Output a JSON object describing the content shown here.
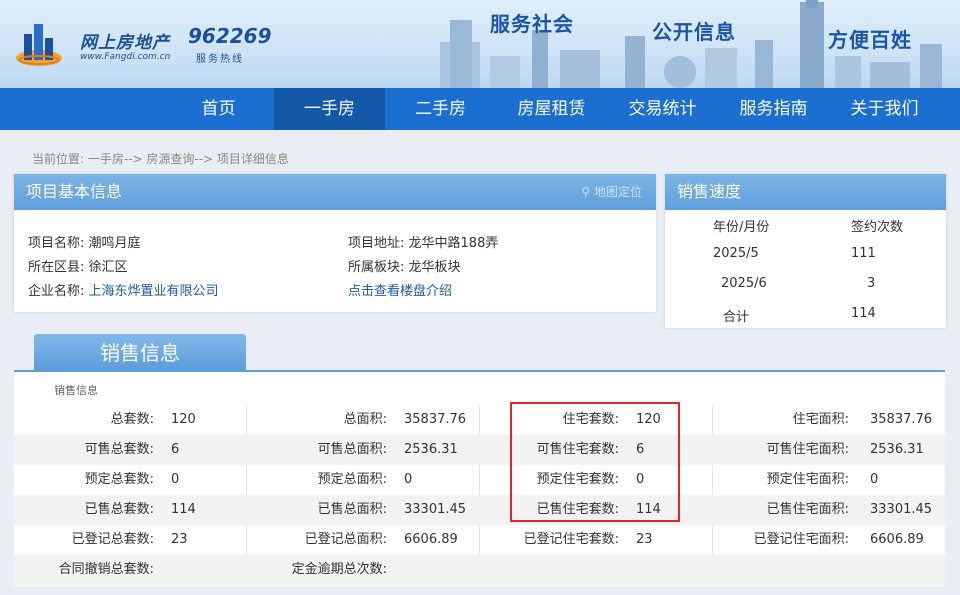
{
  "header": {
    "logo_text": "网上房地产",
    "logo_sub": "www.Fangdi.com.cn",
    "hotline_number": "962269",
    "hotline_label": "服务热线",
    "slogans": [
      "服务社会",
      "公开信息",
      "方便百姓"
    ]
  },
  "nav": {
    "items": [
      "首页",
      "一手房",
      "二手房",
      "房屋租赁",
      "交易统计",
      "服务指南",
      "关于我们"
    ],
    "active": "一手房"
  },
  "breadcrumb": "当前位置:  一手房--> 房源查询--> 项目详细信息",
  "project": {
    "title": "项目基本信息",
    "map_link": "地图定位",
    "name_label": "项目名称:",
    "name": "潮鸣月庭",
    "district_label": "所在区县:",
    "district": "徐汇区",
    "company_label": "企业名称:",
    "company": "上海东烨置业有限公司",
    "address_label": "项目地址:",
    "address": "龙华中路188弄",
    "block_label": "所属板块:",
    "block": "龙华板块",
    "intro_link": "点击查看楼盘介绍"
  },
  "speed": {
    "title": "销售速度",
    "col_month": "年份/月份",
    "col_count": "签约次数",
    "rows": [
      {
        "month": "2025/5",
        "count": "111"
      },
      {
        "month": "2025/6",
        "count": "3"
      },
      {
        "month": "合计",
        "count": "114"
      }
    ]
  },
  "sales": {
    "tab_title": "销售信息",
    "caption": "销售信息",
    "rows": [
      [
        [
          "总套数:",
          "120"
        ],
        [
          "总面积:",
          "35837.76"
        ],
        [
          "住宅套数:",
          "120"
        ],
        [
          "住宅面积:",
          "35837.76"
        ]
      ],
      [
        [
          "可售总套数:",
          "6"
        ],
        [
          "可售总面积:",
          "2536.31"
        ],
        [
          "可售住宅套数:",
          "6"
        ],
        [
          "可售住宅面积:",
          "2536.31"
        ]
      ],
      [
        [
          "预定总套数:",
          "0"
        ],
        [
          "预定总面积:",
          "0"
        ],
        [
          "预定住宅套数:",
          "0"
        ],
        [
          "预定住宅面积:",
          "0"
        ]
      ],
      [
        [
          "已售总套数:",
          "114"
        ],
        [
          "已售总面积:",
          "33301.45"
        ],
        [
          "已售住宅套数:",
          "114"
        ],
        [
          "已售住宅面积:",
          "33301.45"
        ]
      ],
      [
        [
          "已登记总套数:",
          "23"
        ],
        [
          "已登记总面积:",
          "6606.89"
        ],
        [
          "已登记住宅套数:",
          "23"
        ],
        [
          "已登记住宅面积:",
          "6606.89"
        ]
      ],
      [
        [
          "合同撤销总套数:",
          ""
        ],
        [
          "定金逾期总次数:",
          ""
        ],
        [
          "",
          ""
        ],
        [
          "",
          ""
        ]
      ]
    ]
  },
  "colors": {
    "nav_bg": "#1a6fd0",
    "nav_active": "#1459a8",
    "panel_head": "#5f9fdc",
    "highlight": "#e0262d"
  }
}
